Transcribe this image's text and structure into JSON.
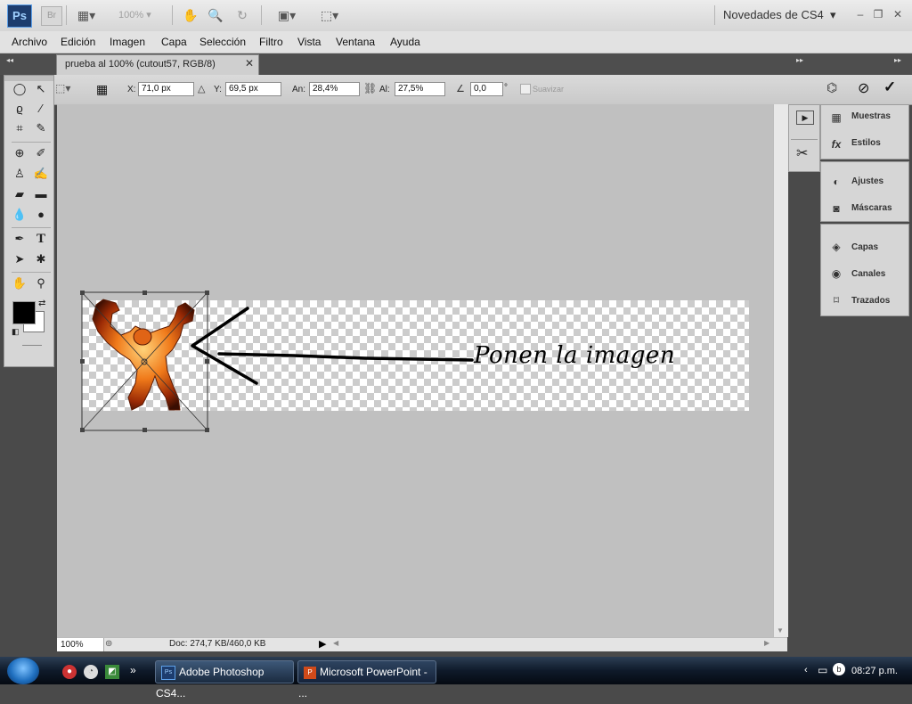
{
  "app": {
    "logo": "Ps",
    "bridge_logo": "Br",
    "zoom_level": "100%",
    "workspace": "Novedades de CS4"
  },
  "menu": [
    "Archivo",
    "Edición",
    "Imagen",
    "Capa",
    "Selección",
    "Filtro",
    "Vista",
    "Ventana",
    "Ayuda"
  ],
  "document": {
    "tab_title": "prueba al 100% (cutout57, RGB/8)",
    "close_glyph": "✕"
  },
  "options": {
    "x_label": "X:",
    "x_value": "71,0 px",
    "y_label": "Y:",
    "y_value": "69,5 px",
    "w_label": "An:",
    "w_value": "28,4%",
    "h_label": "Al:",
    "h_value": "27,5%",
    "angle_value": "0,0",
    "degree_symbol": "°",
    "smooth_label": "Suavizar"
  },
  "annotation": {
    "text": "Ponen la imagen"
  },
  "status": {
    "zoom": "100%",
    "doc": "Doc: 274,7 KB/460,0 KB"
  },
  "panels": {
    "top": [
      "Muestras",
      "Estilos"
    ],
    "mid": [
      "Ajustes",
      "Máscaras"
    ],
    "bot": [
      "Capas",
      "Canales",
      "Trazados"
    ]
  },
  "taskbar": {
    "items": [
      "Adobe Photoshop CS4...",
      "Microsoft PowerPoint - ..."
    ],
    "clock": "08:27 p.m."
  }
}
